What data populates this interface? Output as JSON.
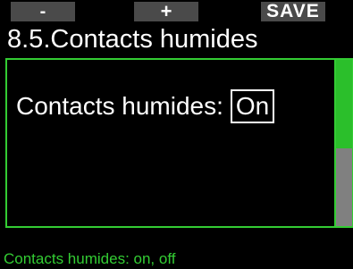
{
  "softkeys": {
    "left_label": "-",
    "middle_label": "+",
    "right_label": "SAVE"
  },
  "header": {
    "title": "8.5.Contacts humides"
  },
  "setting": {
    "label": "Contacts humides:",
    "value": "On"
  },
  "scrollbar": {
    "position_fraction": 0.0,
    "visible_fraction": 0.53
  },
  "footer": {
    "help_text": "Contacts humides: on, off"
  },
  "colors": {
    "background": "#000000",
    "accent_green": "#33cc33",
    "softkey_bg": "#4a4a4a",
    "scroll_track": "#808080",
    "text": "#ffffff"
  }
}
